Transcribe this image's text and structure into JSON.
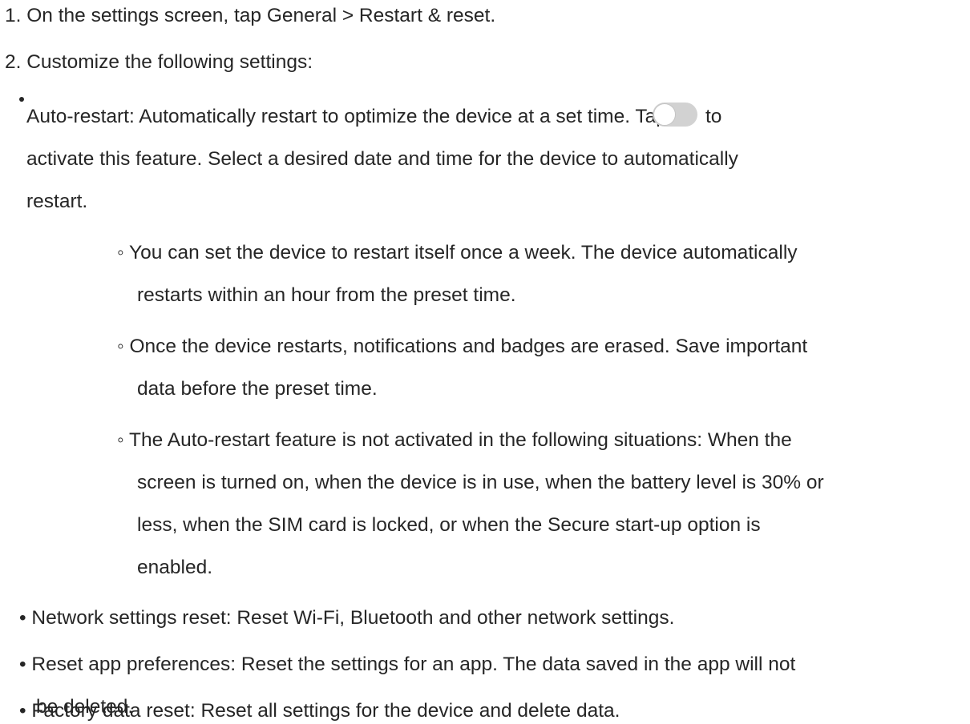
{
  "steps": {
    "step1": "1. On the settings screen, tap General > Restart & reset.",
    "step2": "2. Customize the following settings:"
  },
  "auto_restart": {
    "line1_before_toggle": "Auto-restart: Automatically restart to optimize the device at a set time. Tap",
    "line1_after_toggle": "to",
    "line2": "activate this feature. Select a desired date and time for the device to automatically",
    "line3": "restart.",
    "toggle_state": "off",
    "toggle_icon": "toggle-switch-icon",
    "sub_items": [
      {
        "line1": "◦ You can set the device to restart itself once a week. The device automatically",
        "line2": "restarts within an hour from the preset time."
      },
      {
        "line1": "◦ Once the device restarts, notifications and badges are erased. Save important",
        "line2": "data before the preset time."
      },
      {
        "line1": "◦ The Auto-restart feature is not activated in the following situations: When the",
        "line2": "screen is turned on, when the device is in use, when the battery level is 30% or",
        "line3": "less, when the SIM card is locked, or when the Secure start-up option is",
        "line4": "enabled."
      }
    ]
  },
  "network_reset": {
    "line1": "• Network settings reset: Reset Wi-Fi, Bluetooth and other network settings."
  },
  "app_prefs": {
    "line1": "• Reset app preferences: Reset the settings for an app. The data saved in the app will not",
    "line2": "be deleted."
  },
  "factory_reset": {
    "line1": "• Factory data reset: Reset all settings for the device and delete data."
  },
  "colors": {
    "text": "#262626",
    "toggle_track": "#d2d2d2",
    "toggle_knob": "#ffffff"
  }
}
